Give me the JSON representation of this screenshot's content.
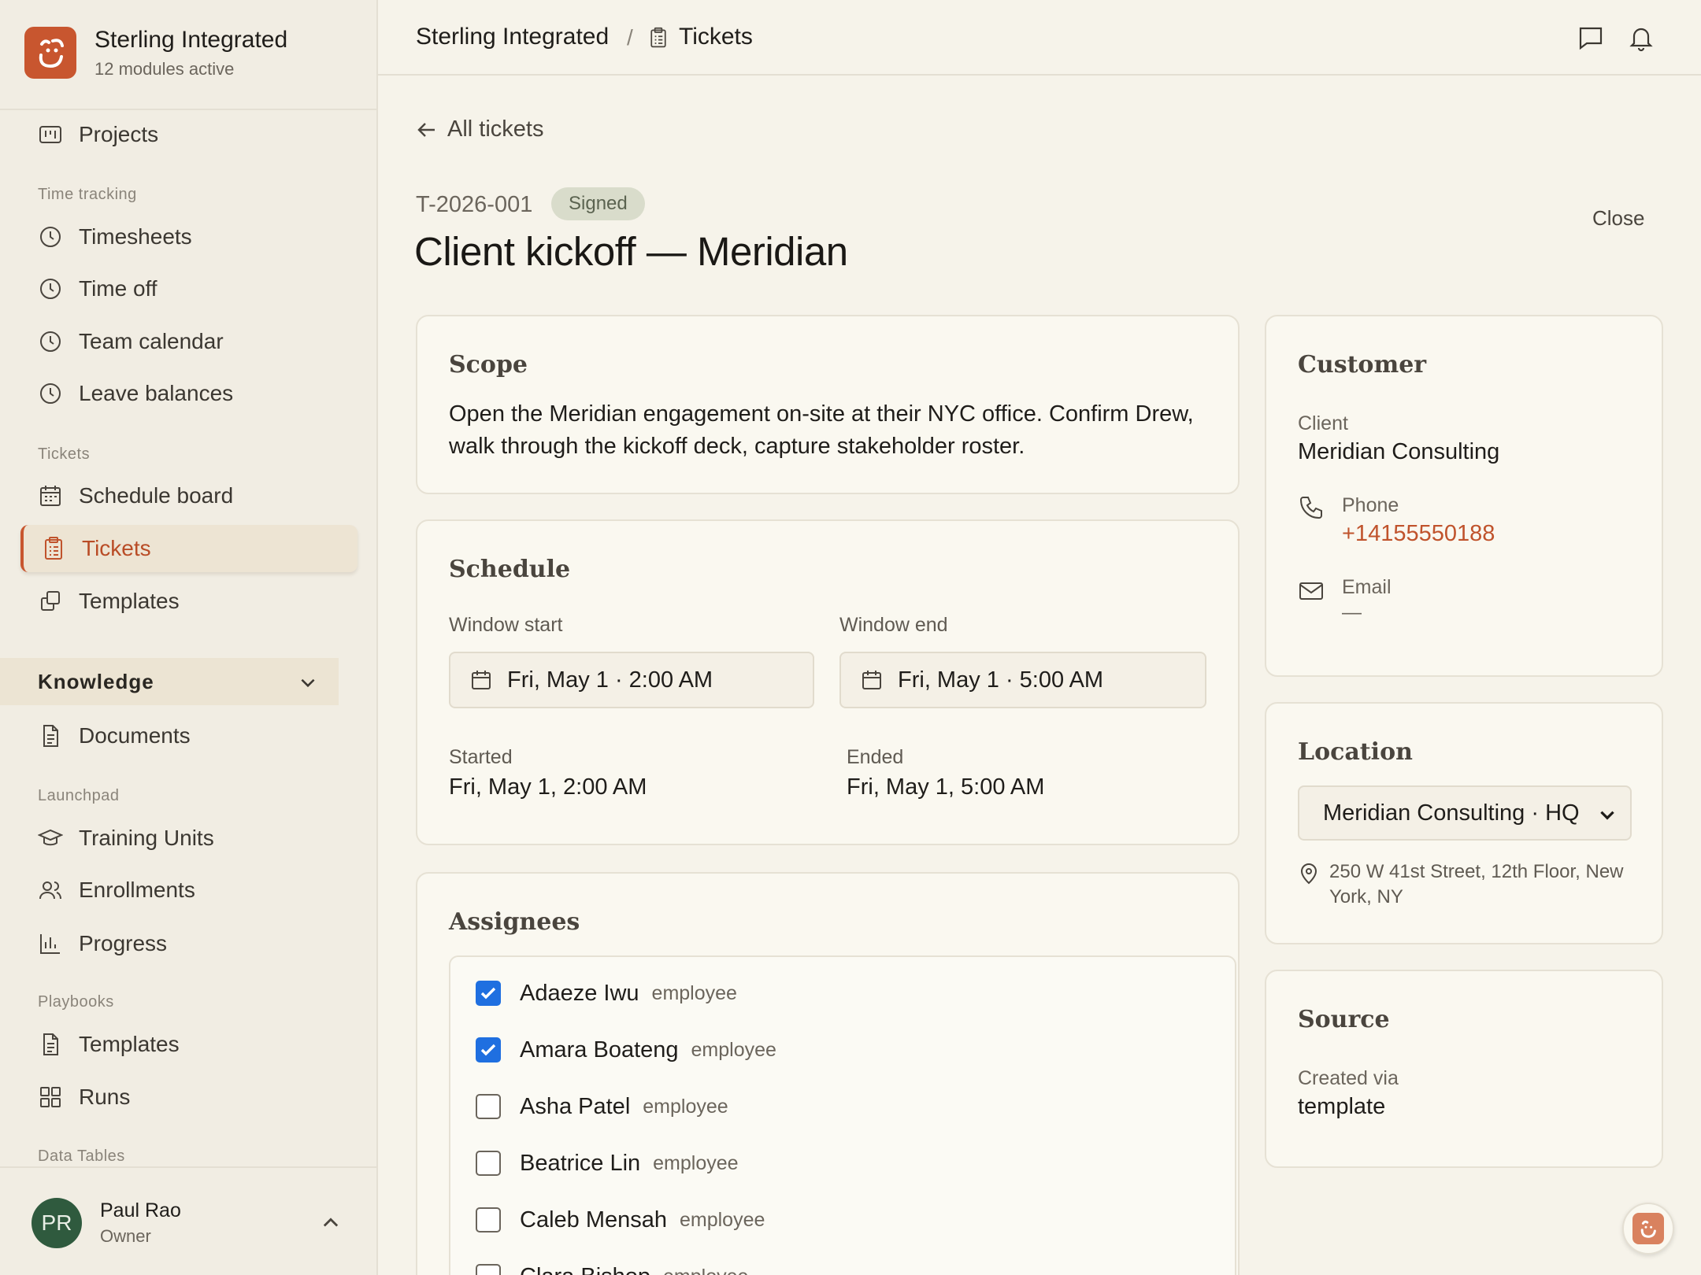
{
  "org": {
    "name": "Sterling Integrated",
    "subtitle": "12 modules active",
    "logo_icon": "smile-logo-icon",
    "brand_color": "#c8562f"
  },
  "sidebar": {
    "items": [
      {
        "label": "Projects",
        "icon": "kanban-icon"
      },
      {
        "label": "Timesheets",
        "icon": "clock-icon"
      },
      {
        "label": "Time off",
        "icon": "clock-icon"
      },
      {
        "label": "Team calendar",
        "icon": "clock-icon"
      },
      {
        "label": "Leave balances",
        "icon": "clock-icon"
      },
      {
        "label": "Schedule board",
        "icon": "calendar-icon"
      },
      {
        "label": "Tickets",
        "icon": "clipboard-icon",
        "active": true
      },
      {
        "label": "Templates",
        "icon": "copy-icon"
      },
      {
        "label": "Documents",
        "icon": "document-icon"
      },
      {
        "label": "Training Units",
        "icon": "graduation-cap-icon"
      },
      {
        "label": "Enrollments",
        "icon": "users-icon"
      },
      {
        "label": "Progress",
        "icon": "bar-chart-icon"
      },
      {
        "label": "Templates",
        "icon": "document-icon"
      },
      {
        "label": "Runs",
        "icon": "grid-icon"
      }
    ],
    "sections": {
      "time_tracking": "Time tracking",
      "tickets": "Tickets",
      "launchpad": "Launchpad",
      "playbooks": "Playbooks",
      "data_tables": "Data Tables"
    },
    "group": {
      "label": "Knowledge",
      "expanded": true
    }
  },
  "user": {
    "initials": "PR",
    "name": "Paul Rao",
    "role": "Owner"
  },
  "breadcrumb": {
    "org": "Sterling Integrated",
    "separator": "/",
    "page": "Tickets"
  },
  "ticket": {
    "back_label": "All tickets",
    "id": "T-2026-001",
    "status": "Signed",
    "title": "Client kickoff — Meridian",
    "close_label": "Close"
  },
  "scope": {
    "title": "Scope",
    "text": "Open the Meridian engagement on-site at their NYC office. Confirm Drew, walk through the kickoff deck, capture stakeholder roster."
  },
  "schedule": {
    "title": "Schedule",
    "window_start_label": "Window start",
    "window_start_value": "Fri, May 1 · 2:00 AM",
    "window_end_label": "Window end",
    "window_end_value": "Fri, May 1 · 5:00 AM",
    "started_label": "Started",
    "started_value": "Fri, May 1, 2:00 AM",
    "ended_label": "Ended",
    "ended_value": "Fri, May 1, 5:00 AM"
  },
  "assignees": {
    "title": "Assignees",
    "rows": [
      {
        "name": "Adaeze Iwu",
        "role": "employee",
        "checked": true
      },
      {
        "name": "Amara Boateng",
        "role": "employee",
        "checked": true
      },
      {
        "name": "Asha Patel",
        "role": "employee",
        "checked": false
      },
      {
        "name": "Beatrice Lin",
        "role": "employee",
        "checked": false
      },
      {
        "name": "Caleb Mensah",
        "role": "employee",
        "checked": false
      },
      {
        "name": "Clara Bishop",
        "role": "employee",
        "checked": false
      }
    ]
  },
  "customer": {
    "title": "Customer",
    "client_label": "Client",
    "client_value": "Meridian Consulting",
    "phone_label": "Phone",
    "phone_value": "+14155550188",
    "email_label": "Email",
    "email_value": "—"
  },
  "location": {
    "title": "Location",
    "selected": "Meridian Consulting · HQ",
    "address": "250 W 41st Street, 12th Floor, New York, NY"
  },
  "source": {
    "title": "Source",
    "created_label": "Created via",
    "created_value": "template"
  }
}
